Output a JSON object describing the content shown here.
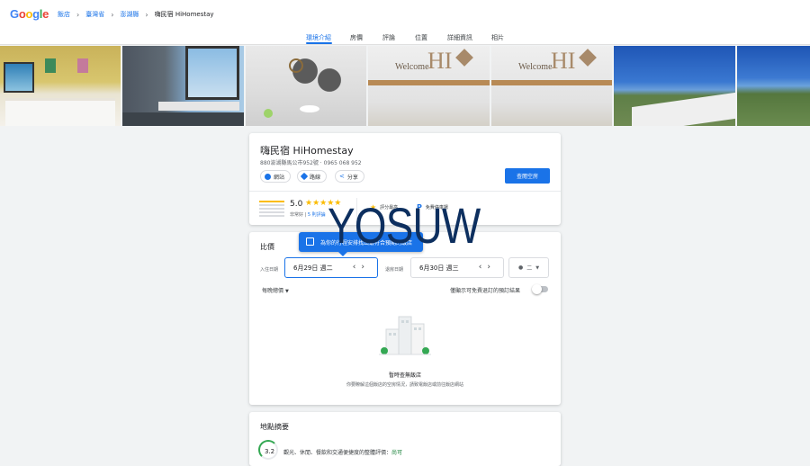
{
  "header": {
    "logo": "Google",
    "breadcrumbs": [
      "飯店",
      "臺灣省",
      "澎湖縣"
    ],
    "current": "嗨民宿 HiHomestay"
  },
  "tabs": [
    "環境介紹",
    "房價",
    "評論",
    "位置",
    "詳細資訊",
    "相片"
  ],
  "hotel": {
    "name": "嗨民宿 HiHomestay",
    "address": "880澎湖縣馬公市952號 · 0965 068 952",
    "actions": [
      "網站",
      "路線",
      "分享"
    ],
    "check_button": "查閱空房",
    "score": "5.0",
    "stars": "★★★★★",
    "rating_word": "非常好",
    "reviews_link": "5 則評論",
    "features": [
      "評分最高",
      "免費停車場"
    ]
  },
  "pricing": {
    "title": "比價",
    "tooltip": "為你的行程安排找出最符合預期的飯店",
    "checkin_label": "入住日期",
    "checkin_value": "6月29日 週二",
    "checkout_label": "退房日期",
    "checkout_value": "6月30日 週三",
    "guests": "二",
    "price_mode": "每晚總價",
    "toggle_label": "僅顯示可免費退訂的預訂結果",
    "empty_title": "暫時查無飯店",
    "empty_sub": "你要瞭解這個飯店的空房情況，請致電飯店或前往飯店網站"
  },
  "location": {
    "title": "地點摘要",
    "score": "3.2",
    "text": "觀光、休閒、餐飲和交通便捷度的整體評價：",
    "good": "尚可"
  },
  "watermark": "YOSUW",
  "colors": {
    "accent": "#1a73e8",
    "star": "#fbbc04",
    "good": "#188038"
  }
}
